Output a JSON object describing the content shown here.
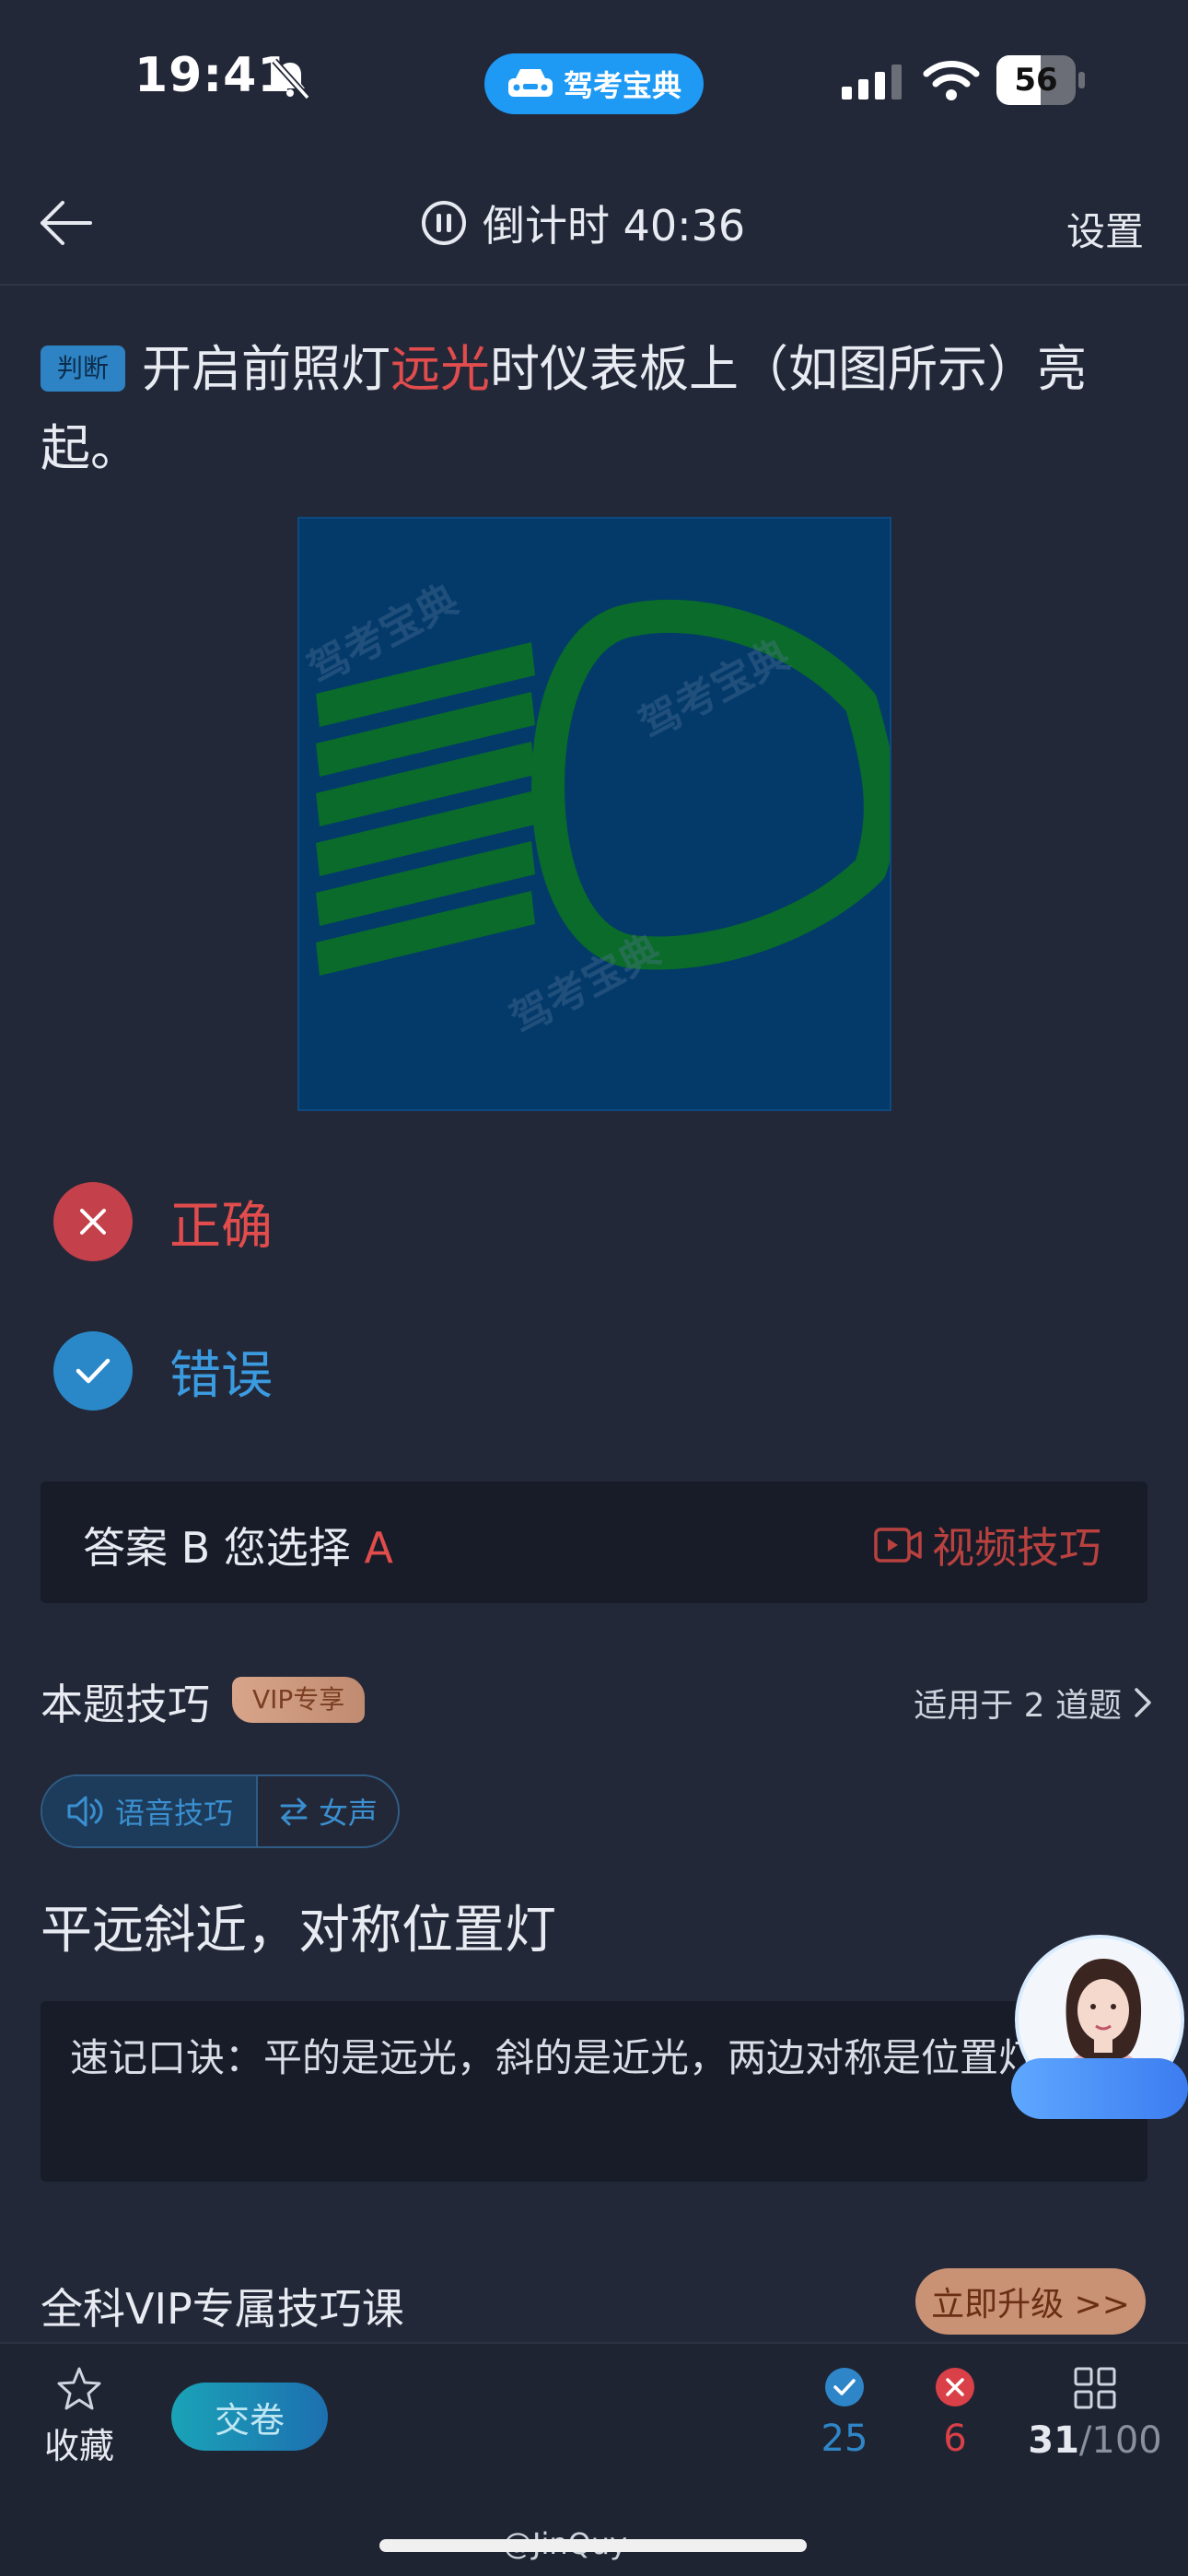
{
  "status_bar": {
    "time": "19:41",
    "app_badge": "驾考宝典",
    "battery": "56",
    "battery_level": 0.56,
    "bell_icon": "bell-muted-icon",
    "signal_icon": "cellular-signal-icon",
    "wifi_icon": "wifi-icon"
  },
  "nav": {
    "back_icon": "back-arrow-icon",
    "timer_label": "倒计时 40:36",
    "settings_label": "设置"
  },
  "question": {
    "type_badge": "判断",
    "text_before": "开启前照灯",
    "text_highlight": "远光",
    "text_after": "时仪表板上（如图所示）亮起。",
    "image_watermark": "驾考宝典"
  },
  "options": [
    {
      "label": "正确",
      "state": "wrong-selected",
      "icon": "x-icon"
    },
    {
      "label": "错误",
      "state": "correct",
      "icon": "check-icon"
    }
  ],
  "answer": {
    "prefix": "答案 B 您选择 ",
    "chosen": "A",
    "video_tip_label": "视频技巧"
  },
  "skill": {
    "title": "本题技巧",
    "vip_badge": "VIP专享",
    "applies_label": "适用于 2 道题",
    "voice_skill_label": "语音技巧",
    "voice_female_label": "女声",
    "mnemonic_title": "平远斜近，对称位置灯",
    "mnemonic_text": "速记口诀：平的是远光，斜的是近光，两边对称是位置灯。"
  },
  "course": {
    "title": "全科VIP专属技巧课",
    "upgrade_label": "立即升级 >>"
  },
  "bottom_bar": {
    "favorite_label": "收藏",
    "submit_label": "交卷",
    "correct_count": "25",
    "wrong_count": "6",
    "progress_current": "31",
    "progress_total": "/100"
  },
  "watermark": "@JinQuy",
  "colors": {
    "background": "#232838",
    "accent_blue": "#2a88c9",
    "error_red": "#e14c4c",
    "vip_gold": "#c99275"
  }
}
